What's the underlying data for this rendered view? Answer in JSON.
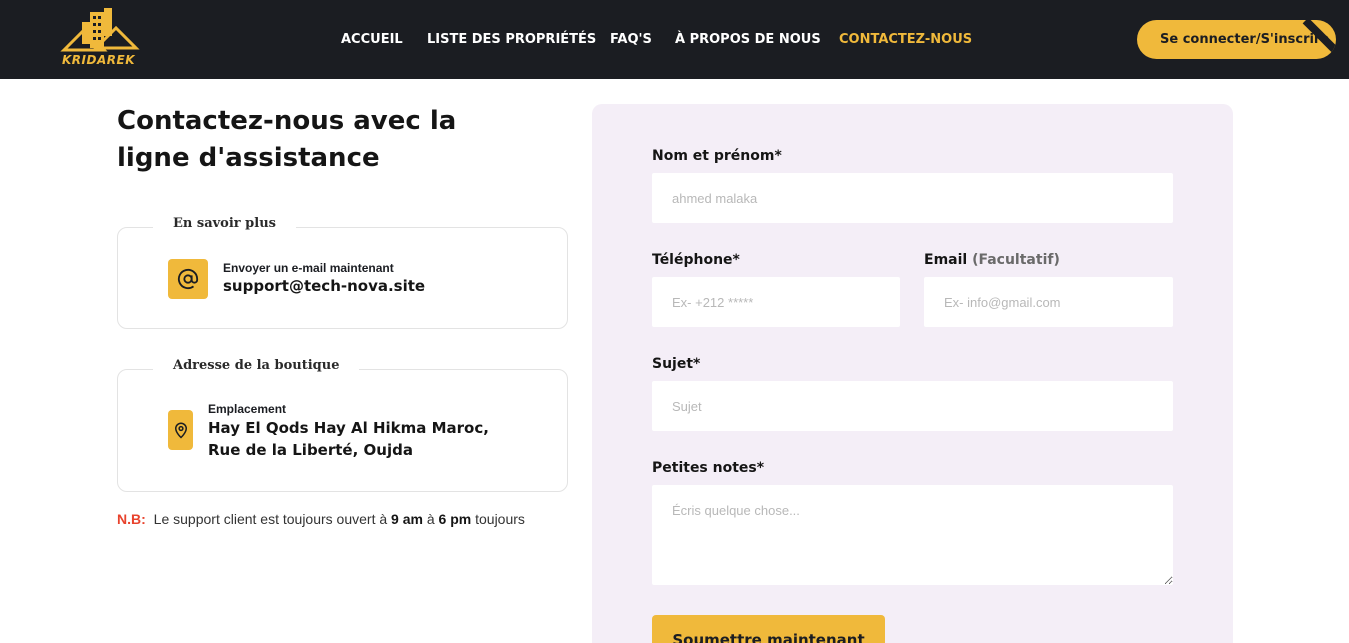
{
  "brand": {
    "name": "KRIDAREK",
    "color": "#f0b93b"
  },
  "nav": {
    "items": [
      "ACCUEIL",
      "LISTE DES PROPRIÉTÉS",
      "FAQ'S",
      "À PROPOS DE NOUS",
      "CONTACTEZ-NOUS"
    ],
    "active": "CONTACTEZ-NOUS"
  },
  "login_label": "Se connecter/S'inscrire",
  "heading": "Contactez-nous avec la ligne d'assistance",
  "email_card": {
    "legend": "En savoir plus",
    "icon": "at-icon",
    "label": "Envoyer un e-mail maintenant",
    "value": "support@tech-nova.site"
  },
  "address_card": {
    "legend": "Adresse de la boutique",
    "icon": "location-pin-icon",
    "label": "Emplacement",
    "line1": "Hay El Qods Hay Al Hikma Maroc,",
    "line2": "Rue de la Liberté, Oujda"
  },
  "note": {
    "prefix": "N.B:",
    "text1": "Le support client est toujours ouvert à",
    "start": "9 am",
    "text2": "à",
    "end": "6 pm",
    "text3": "toujours"
  },
  "form": {
    "name_label": "Nom et prénom*",
    "name_placeholder": "ahmed malaka",
    "phone_label": "Téléphone*",
    "phone_placeholder": "Ex- +212 *****",
    "email_label": "Email",
    "email_optional": "(Facultatif)",
    "email_placeholder": "Ex- info@gmail.com",
    "subject_label": "Sujet*",
    "subject_placeholder": "Sujet",
    "notes_label": "Petites notes*",
    "notes_placeholder": "Écris quelque chose...",
    "submit_label": "Soumettre maintenant"
  },
  "colors": {
    "accent": "#f0b93b",
    "header_bg": "#1b1d22",
    "panel_bg": "#f4eef7",
    "nb": "#e8432d"
  }
}
